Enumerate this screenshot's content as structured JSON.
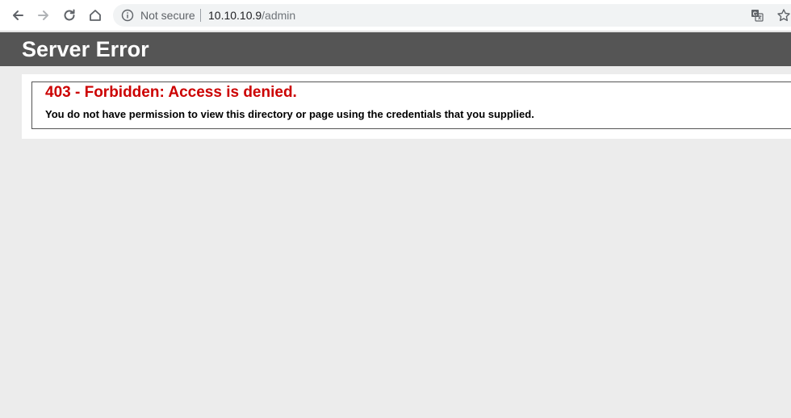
{
  "browser": {
    "security_label": "Not secure",
    "url_host": "10.10.10.9",
    "url_path": "/admin",
    "icons": {
      "back": "back-arrow-icon",
      "forward": "forward-arrow-icon",
      "reload": "reload-icon",
      "home": "home-icon",
      "info": "info-icon",
      "translate": "translate-icon",
      "bookmark": "star-icon"
    }
  },
  "page": {
    "header_title": "Server Error",
    "error_title": "403 - Forbidden: Access is denied.",
    "error_message": "You do not have permission to view this directory or page using the credentials that you supplied."
  },
  "colors": {
    "header_bg": "#555555",
    "error_title": "#cc0000",
    "page_bg": "#ececec"
  }
}
